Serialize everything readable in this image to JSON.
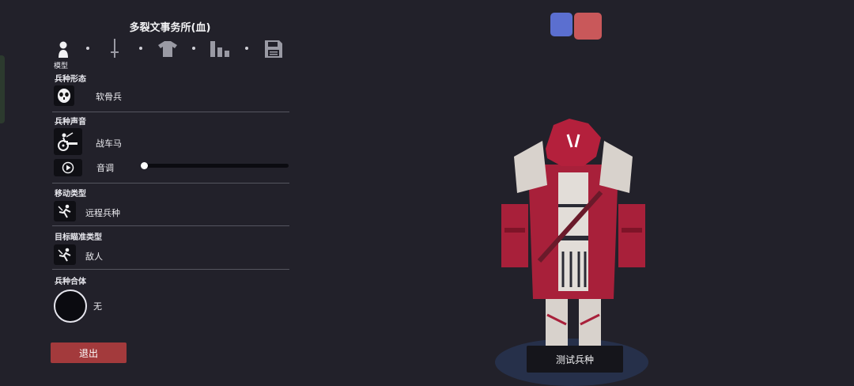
{
  "panel": {
    "title": "多裂文事务所(血)",
    "tabs": [
      {
        "icon": "person-icon"
      },
      {
        "icon": "sword-icon"
      },
      {
        "icon": "shirt-icon"
      },
      {
        "icon": "stats-bars-icon"
      },
      {
        "icon": "save-disk-icon"
      }
    ],
    "active_tab_caption": "模型",
    "unit_form": {
      "label": "兵种形态",
      "icon": "mask-face-icon",
      "value": "软骨兵"
    },
    "unit_sound": {
      "label": "兵种声音",
      "icon": "chariot-icon",
      "value": "战车马",
      "pitch_label": "音调",
      "pitch_level": 0.02
    },
    "movement": {
      "label": "移动类型",
      "icon": "running-figure-icon",
      "value": "远程兵种"
    },
    "targeting": {
      "label": "目标瞄准类型",
      "icon": "running-figure-icon",
      "value": "敌人"
    },
    "combine": {
      "label": "兵种合体",
      "value": "无"
    },
    "exit_label": "退出"
  },
  "team_colors": {
    "blue": "#5b6fd0",
    "red": "#c9585a"
  },
  "preview": {
    "test_label": "测试兵种"
  },
  "colors": {
    "background": "#22212a",
    "exit": "#a33a3c",
    "armor_red": "#a8203a",
    "armor_white": "#d8d2cc"
  }
}
